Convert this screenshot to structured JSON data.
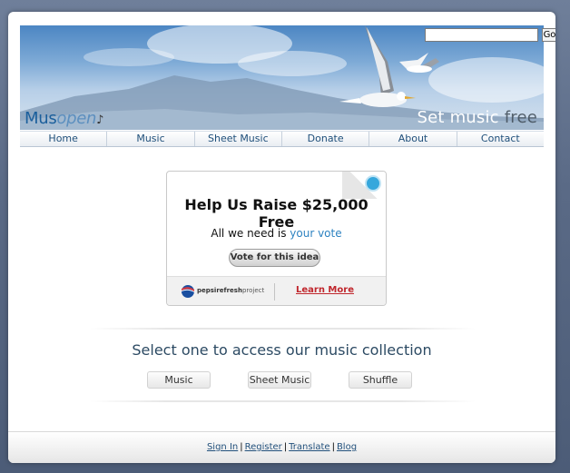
{
  "search": {
    "value": "",
    "placeholder": "",
    "go_label": "Go"
  },
  "banner": {
    "logo_mus": "Mus",
    "logo_open": "open",
    "tagline_main": "Set music ",
    "tagline_free": "free"
  },
  "nav": {
    "items": [
      {
        "label": "Home"
      },
      {
        "label": "Music"
      },
      {
        "label": "Sheet Music"
      },
      {
        "label": "Donate"
      },
      {
        "label": "About"
      },
      {
        "label": "Contact"
      }
    ]
  },
  "widget": {
    "title": "Help Us Raise $25,000 Free",
    "sub_prefix": "All we need is ",
    "sub_highlight": "your vote",
    "vote_label": "Vote for this idea",
    "sponsor_text_bold": "pepsirefresh",
    "sponsor_text_rest": "project",
    "learn_more": "Learn More"
  },
  "collection": {
    "heading": "Select one to access our music collection",
    "buttons": [
      {
        "label": "Music"
      },
      {
        "label": "Sheet Music"
      },
      {
        "label": "Shuffle"
      }
    ]
  },
  "footer": {
    "links": [
      {
        "label": "Sign In"
      },
      {
        "label": "Register"
      },
      {
        "label": "Translate"
      },
      {
        "label": "Blog"
      }
    ],
    "separator": "|"
  },
  "colors": {
    "brand_blue": "#1b5f9c",
    "nav_text": "#1f4f7a",
    "learn_more_red": "#c0272d",
    "highlight_blue": "#2e83c1"
  }
}
